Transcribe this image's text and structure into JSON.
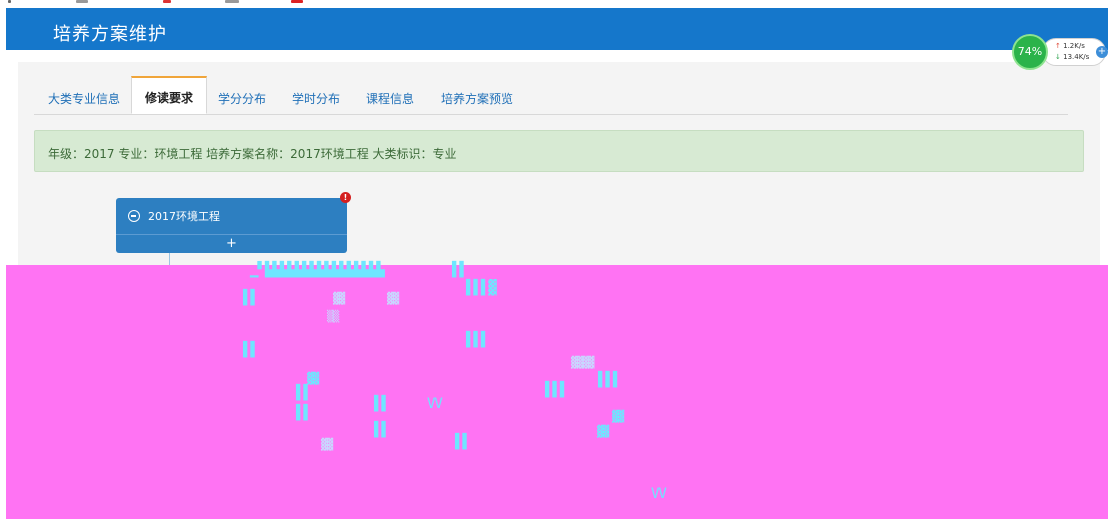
{
  "header": {
    "title": "培养方案维护"
  },
  "tabs": [
    {
      "label": "大类专业信息",
      "active": false
    },
    {
      "label": "修读要求",
      "active": true
    },
    {
      "label": "学分分布",
      "active": false
    },
    {
      "label": "学时分布",
      "active": false
    },
    {
      "label": "课程信息",
      "active": false
    },
    {
      "label": "培养方案预览",
      "active": false
    }
  ],
  "info_bar": {
    "text": "年级：2017 专业：环境工程 培养方案名称：2017环境工程 大类标识：专业"
  },
  "tree": {
    "node_title": "2017环境工程",
    "add_label": "+",
    "badge": "!"
  },
  "network_widget": {
    "percent": "74%",
    "up_speed": "1.2K/s",
    "down_speed": "13.4K/s",
    "add_label": "+"
  },
  "colors": {
    "header": "#1577cb",
    "node": "#2d7fc1",
    "info_bg": "#d7ead3",
    "artifact": "#ff73f3"
  }
}
